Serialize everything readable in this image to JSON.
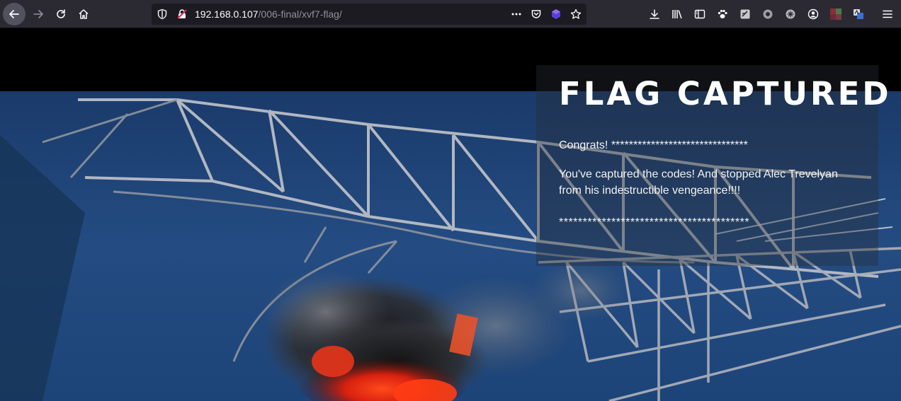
{
  "browser": {
    "url_host": "192.168.0.107",
    "url_path": "/006-final/xvf7-flag/"
  },
  "icons": [
    "back-arrow-icon",
    "forward-arrow-icon",
    "reload-icon",
    "home-icon",
    "shield-icon",
    "insecure-lock-icon",
    "more-icon",
    "pocket-icon",
    "extension-cube-icon",
    "bookmark-star-icon",
    "download-icon",
    "library-icon",
    "sidebar-icon",
    "extension-paw-icon",
    "extension-notes-icon",
    "extension-circle-icon",
    "extension-gear-icon",
    "account-icon",
    "extension-color-icon",
    "translate-icon",
    "menu-icon"
  ],
  "page": {
    "title": "FLAG CAPTURED",
    "congrats": "Congrats! *******************************",
    "message": "You've captured the codes! And stopped Alec Trevelyan from his indestructible vengeance!!!!",
    "stars": "****************************************"
  },
  "colors": {
    "toolbar_bg": "#2b2a33",
    "urlbar_bg": "#1c1b22",
    "sky_blue": "#1f4577",
    "title_color": "#ffffff"
  }
}
